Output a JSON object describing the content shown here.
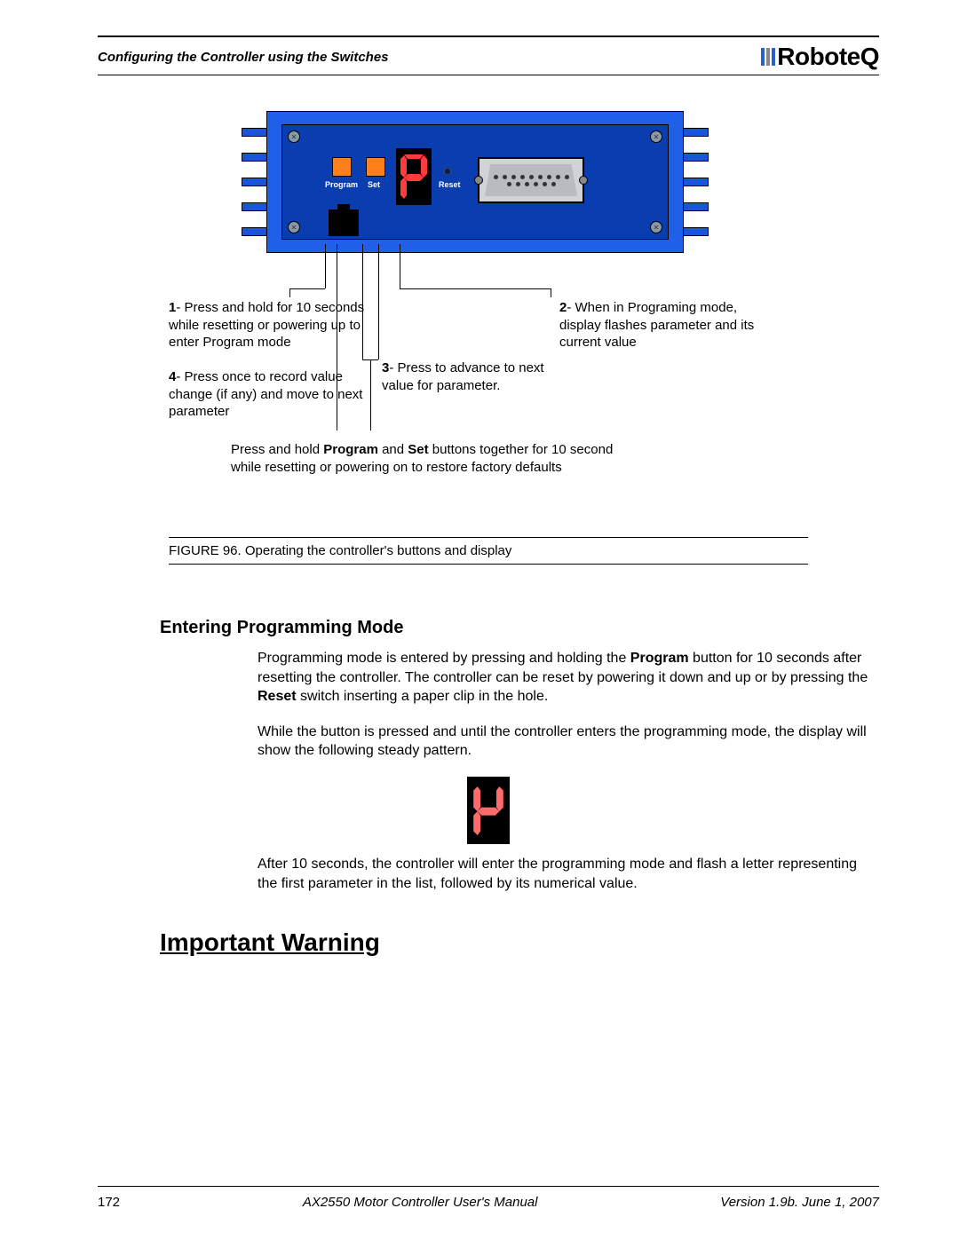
{
  "header": {
    "section_title": "Configuring the Controller using the Switches",
    "logo_text": "RoboteQ"
  },
  "device_labels": {
    "program": "Program",
    "set": "Set",
    "reset": "Reset"
  },
  "callouts": {
    "c1": {
      "num": "1",
      "text": "- Press and hold for 10 seconds while resetting or powering up to enter Program mode"
    },
    "c4": {
      "num": "4",
      "text": "- Press once to record value change (if any) and move to next parameter"
    },
    "c3": {
      "num": "3",
      "text": "- Press to advance to next value for parameter."
    },
    "c2": {
      "num": "2",
      "text": "- When in Programing mode, display flashes parameter and its current value"
    },
    "combined": "Press and hold <b>Program</b> and <b>Set</b> buttons together for 10 second while resetting or powering on to restore factory defaults"
  },
  "figure_caption": "FIGURE 96.  Operating the controller's buttons and display",
  "sections": {
    "entering": {
      "heading": "Entering Programming Mode",
      "p1": "Programming mode is entered by pressing and holding the <b>Program</b> button for 10 seconds after resetting the controller. The controller can be reset by powering it down and up or by pressing the <b>Reset</b> switch inserting a paper clip in the hole.",
      "p2": "While the button is pressed and until the controller enters the programming mode, the display will show the following steady pattern.",
      "p3": "After 10 seconds, the controller will enter the programming mode and flash a letter representing the first parameter in the list, followed by its numerical value."
    },
    "warning_heading": "Important Warning"
  },
  "footer": {
    "page": "172",
    "manual": "AX2550 Motor Controller User's Manual",
    "version": "Version 1.9b. June 1, 2007"
  }
}
